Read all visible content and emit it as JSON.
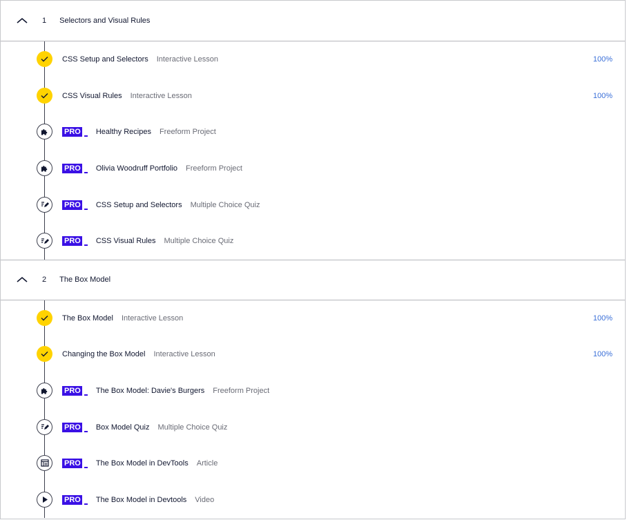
{
  "modules": [
    {
      "number": "1",
      "title": "Selectors and Visual Rules",
      "items": [
        {
          "title": "CSS Setup and Selectors",
          "type": "Interactive Lesson",
          "progress": "100%",
          "pro": false,
          "icon": "check-icon"
        },
        {
          "title": "CSS Visual Rules",
          "type": "Interactive Lesson",
          "progress": "100%",
          "pro": false,
          "icon": "check-icon"
        },
        {
          "title": "Healthy Recipes",
          "type": "Freeform Project",
          "progress": "",
          "pro": true,
          "icon": "puzzle-icon"
        },
        {
          "title": "Olivia Woodruff Portfolio",
          "type": "Freeform Project",
          "progress": "",
          "pro": true,
          "icon": "puzzle-icon"
        },
        {
          "title": "CSS Setup and Selectors",
          "type": "Multiple Choice Quiz",
          "progress": "",
          "pro": true,
          "icon": "quiz-icon"
        },
        {
          "title": "CSS Visual Rules",
          "type": "Multiple Choice Quiz",
          "progress": "",
          "pro": true,
          "icon": "quiz-icon"
        }
      ]
    },
    {
      "number": "2",
      "title": "The Box Model",
      "items": [
        {
          "title": "The Box Model",
          "type": "Interactive Lesson",
          "progress": "100%",
          "pro": false,
          "icon": "check-icon"
        },
        {
          "title": "Changing the Box Model",
          "type": "Interactive Lesson",
          "progress": "100%",
          "pro": false,
          "icon": "check-icon"
        },
        {
          "title": "The Box Model: Davie's Burgers",
          "type": "Freeform Project",
          "progress": "",
          "pro": true,
          "icon": "puzzle-icon"
        },
        {
          "title": "Box Model Quiz",
          "type": "Multiple Choice Quiz",
          "progress": "",
          "pro": true,
          "icon": "quiz-icon"
        },
        {
          "title": "The Box Model in DevTools",
          "type": "Article",
          "progress": "",
          "pro": true,
          "icon": "article-icon"
        },
        {
          "title": "The Box Model in Devtools",
          "type": "Video",
          "progress": "",
          "pro": true,
          "icon": "play-icon"
        }
      ]
    }
  ],
  "pro_label": "PRO",
  "colors": {
    "complete": "#ffd300",
    "pro": "#3a10e5",
    "progress": "#3a6fd8",
    "type_text": "#696b75"
  }
}
